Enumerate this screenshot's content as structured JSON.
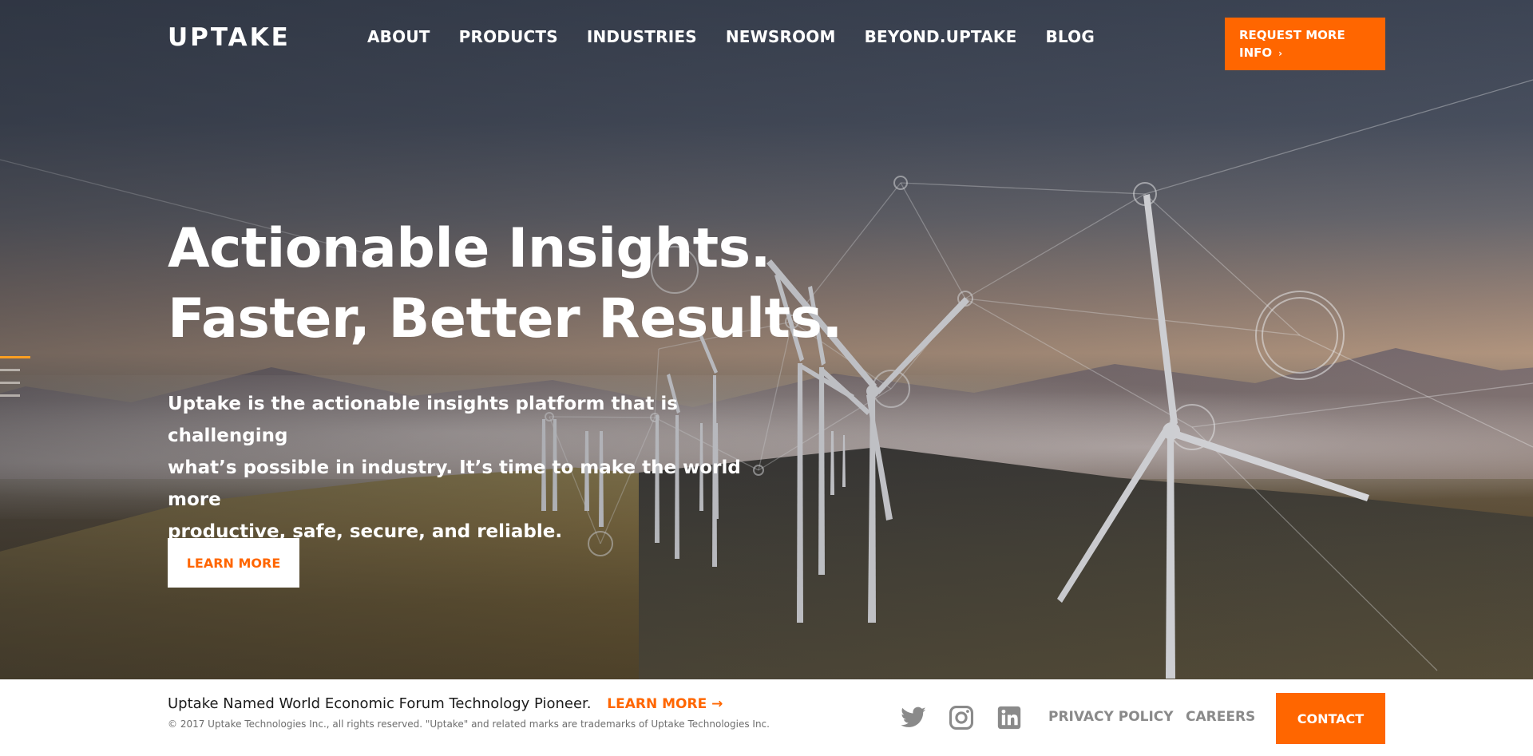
{
  "brand": {
    "logo_text": "UPTAKE"
  },
  "nav": {
    "items": [
      {
        "label": "ABOUT"
      },
      {
        "label": "PRODUCTS"
      },
      {
        "label": "INDUSTRIES"
      },
      {
        "label": "NEWSROOM"
      },
      {
        "label": "BEYOND.UPTAKE"
      },
      {
        "label": "BLOG"
      }
    ],
    "cta": {
      "line1": "REQUEST MORE",
      "line2": "INFO",
      "chevron": "›"
    }
  },
  "hero": {
    "headline_line1": "Actionable Insights.",
    "headline_line2": "Faster, Better Results.",
    "subtext_line1": "Uptake is the actionable insights platform that is challenging",
    "subtext_line2": "what’s possible in industry. It’s time to make the world more",
    "subtext_line3": "productive, safe, secure, and reliable.",
    "button_label": "LEARN MORE",
    "slide_indicator": {
      "count": 4,
      "active_index": 0
    }
  },
  "footer": {
    "news_text": "Uptake Named World Economic Forum Technology Pioneer.",
    "news_link": "LEARN MORE →",
    "copyright": "© 2017 Uptake Technologies Inc., all rights reserved. \"Uptake\" and related marks are trademarks of Uptake Technologies Inc.",
    "social": [
      "twitter-icon",
      "instagram-icon",
      "linkedin-icon"
    ],
    "links": {
      "privacy": "PRIVACY POLICY",
      "careers": "CAREERS"
    },
    "contact_label": "CONTACT"
  },
  "colors": {
    "accent": "#ff6600",
    "indicator_active": "#ff9f22",
    "footer_link": "#8a8a8a",
    "social_icon": "#8a8a8a"
  }
}
